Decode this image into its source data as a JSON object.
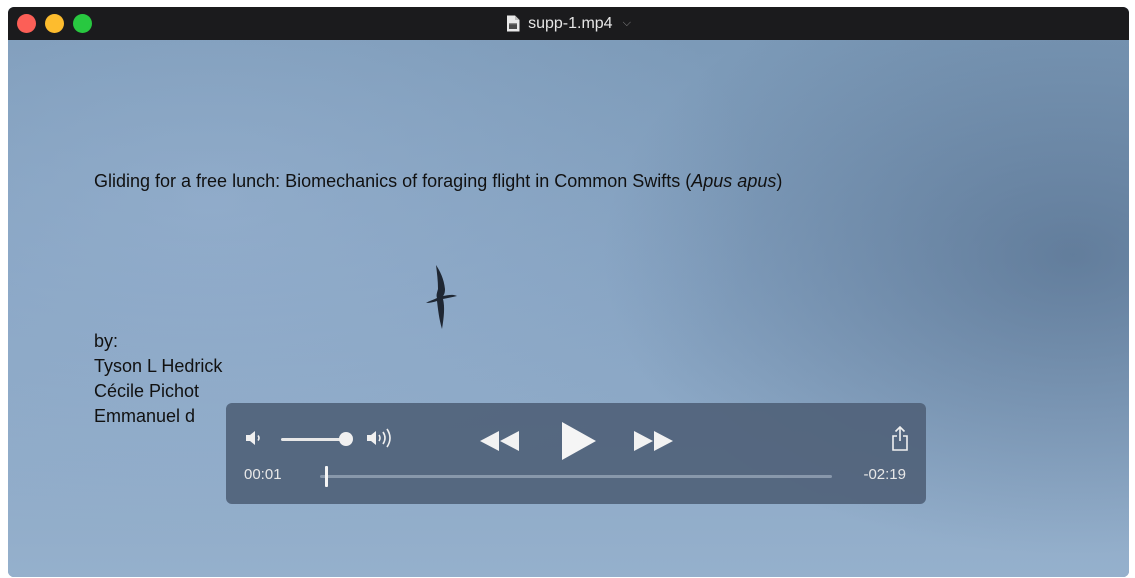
{
  "window": {
    "title": "supp-1.mp4",
    "traffic_lights": [
      "close",
      "minimize",
      "zoom"
    ],
    "title_icon": "movie-file-icon",
    "title_menu_icon": "chevron-down-icon"
  },
  "video": {
    "title_main": "Gliding for a free lunch: Biomechanics of foraging flight in Common Swifts (",
    "title_species": "Apus apus",
    "title_close": ")",
    "credits": {
      "by": "by:",
      "authors": [
        "Tyson L Hedrick",
        "Cécile Pichot",
        "Emmanuel d"
      ]
    }
  },
  "controls": {
    "current_time": "00:01",
    "remaining_time": "-02:19",
    "playback_progress": 0.007,
    "volume_level": 0.9,
    "icons": {
      "volume_low": "volume-low-icon",
      "volume_high": "volume-high-icon",
      "rewind": "rewind-icon",
      "play": "play-icon",
      "fast_forward": "fast-forward-icon",
      "share": "share-icon"
    }
  },
  "colors": {
    "titlebar_bg": "#1b1b1d",
    "close": "#fc5f57",
    "minimize": "#fdbc2e",
    "zoom": "#28c840",
    "sky": "#86a3c2",
    "controls_bg": "#50627a"
  }
}
